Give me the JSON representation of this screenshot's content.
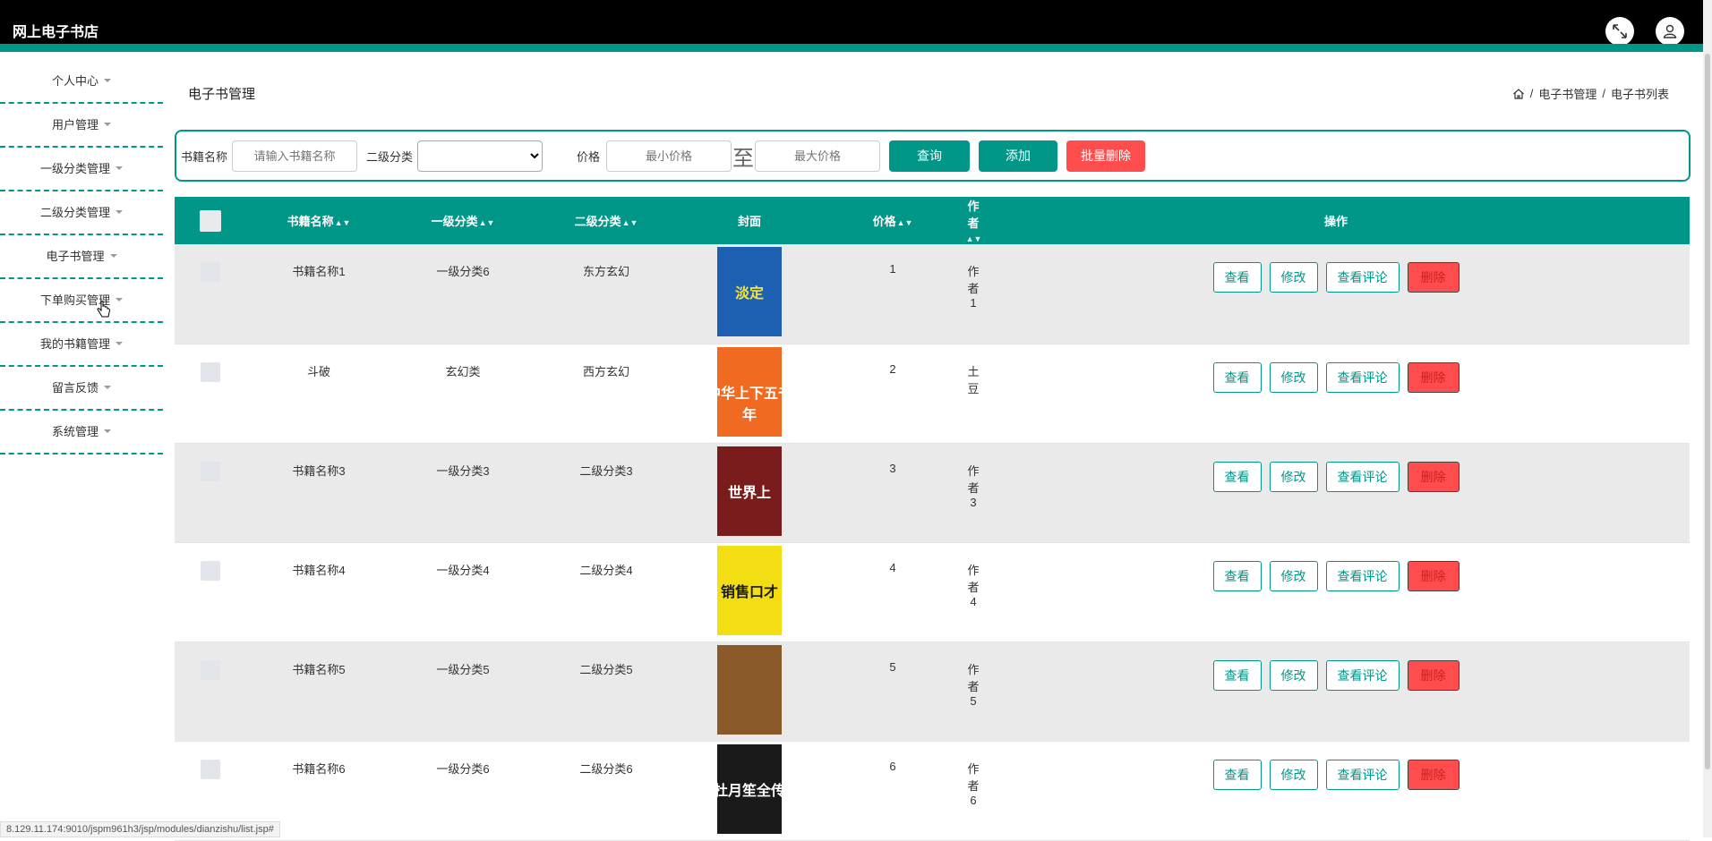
{
  "app": {
    "title": "网上电子书店"
  },
  "sidebar": {
    "items": [
      {
        "label": "个人中心"
      },
      {
        "label": "用户管理"
      },
      {
        "label": "一级分类管理"
      },
      {
        "label": "二级分类管理"
      },
      {
        "label": "电子书管理"
      },
      {
        "label": "下单购买管理"
      },
      {
        "label": "我的书籍管理"
      },
      {
        "label": "留言反馈"
      },
      {
        "label": "系统管理"
      }
    ]
  },
  "page": {
    "title": "电子书管理",
    "breadcrumb": [
      "电子书管理",
      "电子书列表"
    ]
  },
  "search": {
    "name_label": "书籍名称",
    "name_placeholder": "请输入书籍名称",
    "category_label": "二级分类",
    "price_label": "价格",
    "min_placeholder": "最小价格",
    "to_label": "至",
    "max_placeholder": "最大价格",
    "query_btn": "查询",
    "add_btn": "添加",
    "batch_delete_btn": "批量删除"
  },
  "colors": {
    "accent": "#009688",
    "danger": "#ff4d4d",
    "topbar": "#000000"
  },
  "table": {
    "headers": {
      "name": "书籍名称",
      "cat1": "一级分类",
      "cat2": "二级分类",
      "cover": "封面",
      "price": "价格",
      "author": "作者",
      "ops": "操作"
    },
    "action_labels": {
      "view": "查看",
      "edit": "修改",
      "comments": "查看评论",
      "delete": "删除"
    },
    "rows": [
      {
        "name": "书籍名称1",
        "cat1": "一级分类6",
        "cat2": "东方玄幻",
        "price": "1",
        "author": "作者1",
        "cover_text": "淡定"
      },
      {
        "name": "斗破",
        "cat1": "玄幻类",
        "cat2": "西方玄幻",
        "price": "2",
        "author": "土豆",
        "cover_text": "中华上下五千年"
      },
      {
        "name": "书籍名称3",
        "cat1": "一级分类3",
        "cat2": "二级分类3",
        "price": "3",
        "author": "作者3",
        "cover_text": "世界上"
      },
      {
        "name": "书籍名称4",
        "cat1": "一级分类4",
        "cat2": "二级分类4",
        "price": "4",
        "author": "作者4",
        "cover_text": "销售口才"
      },
      {
        "name": "书籍名称5",
        "cat1": "一级分类5",
        "cat2": "二级分类5",
        "price": "5",
        "author": "作者5",
        "cover_text": ""
      },
      {
        "name": "书籍名称6",
        "cat1": "一级分类6",
        "cat2": "二级分类6",
        "price": "6",
        "author": "作者6",
        "cover_text": "杜月笙全传"
      }
    ]
  },
  "status": {
    "url": "8.129.11.174:9010/jspm961h3/jsp/modules/dianzishu/list.jsp#"
  }
}
